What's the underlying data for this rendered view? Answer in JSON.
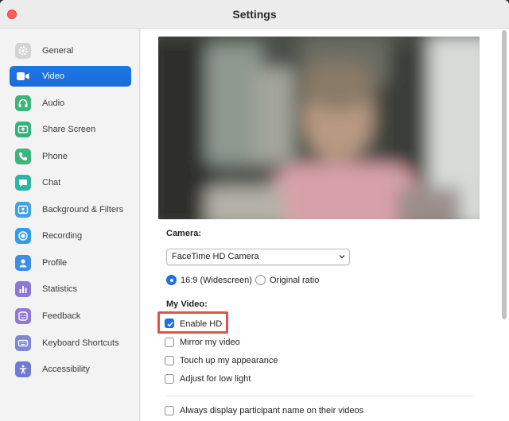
{
  "window": {
    "title": "Settings"
  },
  "sidebar": {
    "items": [
      {
        "label": "General",
        "icon": "gear-icon",
        "color": "#b9b9b9",
        "active": false
      },
      {
        "label": "Video",
        "icon": "video-camera-icon",
        "color": "#1a73e8",
        "active": true
      },
      {
        "label": "Audio",
        "icon": "headphones-icon",
        "color": "#3bb57a",
        "active": false
      },
      {
        "label": "Share Screen",
        "icon": "share-screen-icon",
        "color": "#34b27b",
        "active": false
      },
      {
        "label": "Phone",
        "icon": "phone-icon",
        "color": "#3bb57a",
        "active": false
      },
      {
        "label": "Chat",
        "icon": "chat-bubble-icon",
        "color": "#2eb5a3",
        "active": false
      },
      {
        "label": "Background & Filters",
        "icon": "background-image-icon",
        "color": "#3ea3e0",
        "active": false
      },
      {
        "label": "Recording",
        "icon": "record-icon",
        "color": "#2f9de8",
        "active": false
      },
      {
        "label": "Profile",
        "icon": "person-icon",
        "color": "#3d8ee6",
        "active": false
      },
      {
        "label": "Statistics",
        "icon": "bar-chart-icon",
        "color": "#8c77d6",
        "active": false
      },
      {
        "label": "Feedback",
        "icon": "smiley-icon",
        "color": "#8f78d8",
        "active": false
      },
      {
        "label": "Keyboard Shortcuts",
        "icon": "keyboard-icon",
        "color": "#7d86d9",
        "active": false
      },
      {
        "label": "Accessibility",
        "icon": "accessibility-icon",
        "color": "#6e7bd6",
        "active": false
      }
    ]
  },
  "video": {
    "camera_label": "Camera:",
    "camera_value": "FaceTime HD Camera",
    "ratio_options": [
      "16:9 (Widescreen)",
      "Original ratio"
    ],
    "ratio_selected": "16:9 (Widescreen)",
    "my_video_label": "My Video:",
    "options": [
      {
        "label": "Enable HD",
        "checked": true
      },
      {
        "label": "Mirror my video",
        "checked": false
      },
      {
        "label": "Touch up my appearance",
        "checked": false
      },
      {
        "label": "Adjust for low light",
        "checked": false
      }
    ],
    "participant_name_label": "Always display participant name on their videos",
    "participant_name_checked": false
  },
  "colors": {
    "accent": "#1a73e8",
    "highlight": "#e0524e"
  }
}
